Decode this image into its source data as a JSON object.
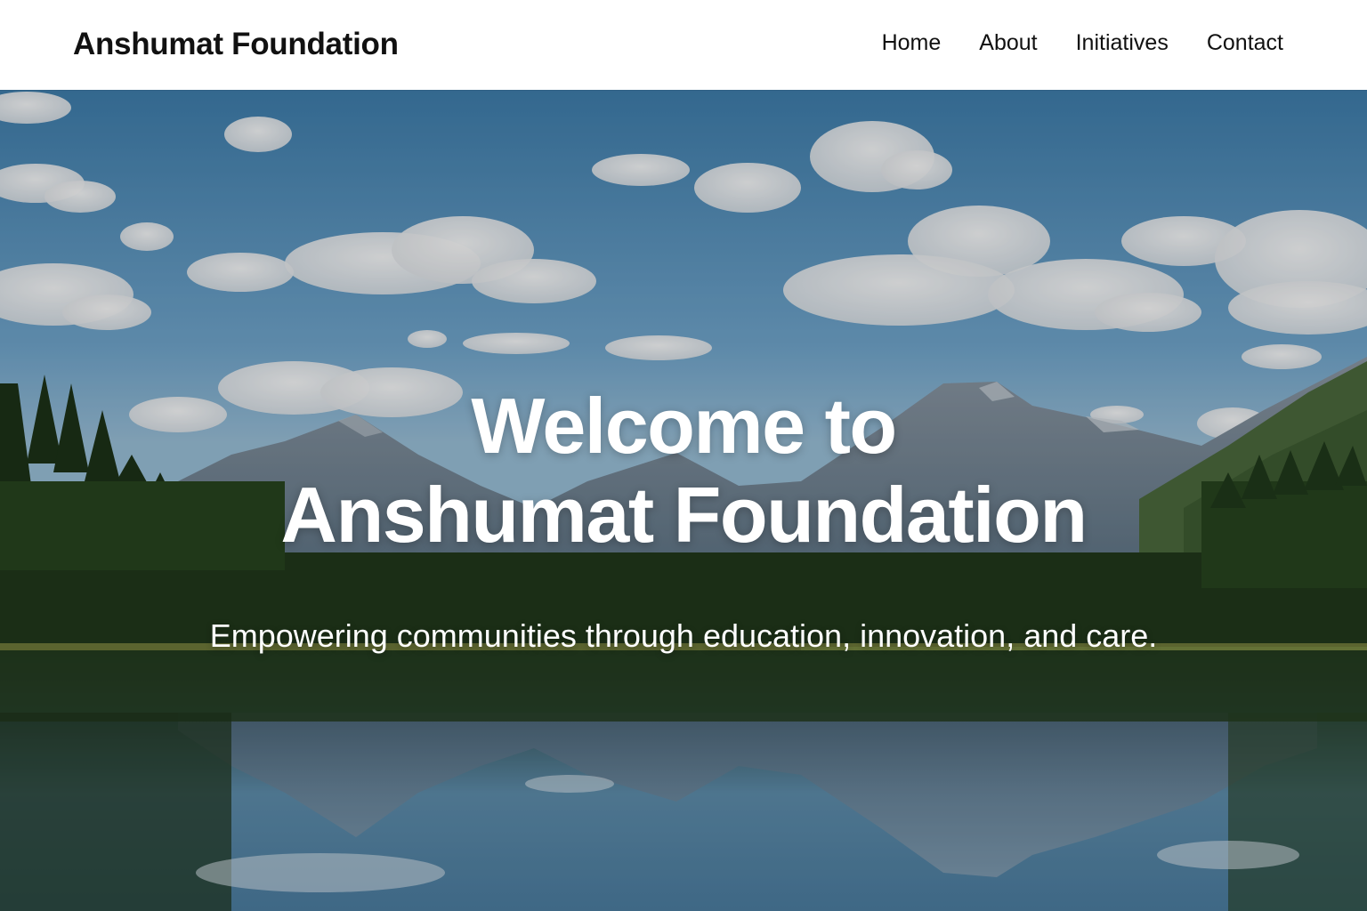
{
  "header": {
    "brand": "Anshumat Foundation",
    "nav": [
      {
        "label": "Home"
      },
      {
        "label": "About"
      },
      {
        "label": "Initiatives"
      },
      {
        "label": "Contact"
      }
    ]
  },
  "hero": {
    "title_line1": "Welcome to",
    "title_line2": "Anshumat Foundation",
    "subtitle": "Empowering communities through education, innovation, and care.",
    "background": "mountain-lake-landscape"
  },
  "colors": {
    "header_bg": "#ffffff",
    "text_dark": "#111111",
    "hero_text": "#ffffff",
    "sky": "#5f9bc6",
    "forest": "#27421f",
    "water": "#3f6f8e"
  }
}
